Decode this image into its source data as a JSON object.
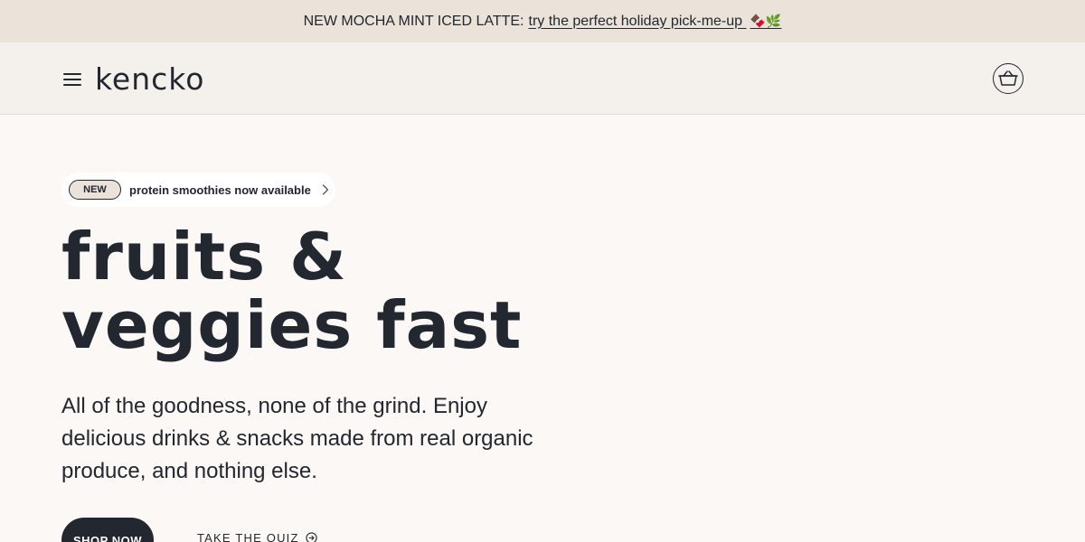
{
  "announcement": {
    "prefix": "NEW MOCHA MINT ICED LATTE:",
    "link_text": "try the perfect holiday pick-me-up",
    "emoji": "🍫🌿"
  },
  "header": {
    "logo": "kencko",
    "menu_icon": "hamburger-menu-icon",
    "cart_icon": "shopping-basket-icon"
  },
  "promo": {
    "badge": "NEW",
    "text": "protein smoothies now available",
    "icon": "chevron-right-icon"
  },
  "hero": {
    "title_line1": "fruits &",
    "title_line2": "veggies fast",
    "subtitle": "All of the goodness, none of the grind. Enjoy delicious drinks & snacks made from real organic produce, and nothing else."
  },
  "cta": {
    "shop_label": "SHOP NOW",
    "quiz_label": "TAKE THE QUIZ",
    "quiz_icon": "arrow-circle-right-icon"
  },
  "colors": {
    "ink": "#222730",
    "announcement_bg": "#ebe2d9",
    "header_bg": "#f4f1ed",
    "page_bg": "#fcf8f5"
  }
}
